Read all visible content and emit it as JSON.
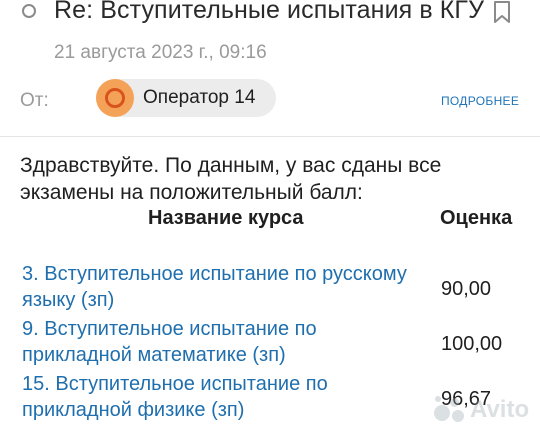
{
  "email": {
    "subject": "Re: Вступительные испытания в КГУ",
    "date": "21 августа 2023 г., 09:16",
    "from_label": "От:",
    "sender_name": "Оператор 14",
    "details_link": "ПОДРОБНЕЕ",
    "greeting": "Здравствуйте. По данным, у вас сданы все экзамены на положительный балл:"
  },
  "table": {
    "headers": {
      "course": "Название курса",
      "grade": "Оценка"
    },
    "rows": [
      {
        "course": "3. Вступительное испытание по русскому языку (зп)",
        "grade": "90,00"
      },
      {
        "course": "9. Вступительное испытание по прикладной математике (зп)",
        "grade": "100,00"
      },
      {
        "course": "15. Вступительное испытание по прикладной физике (зп)",
        "grade": "96,67"
      }
    ]
  },
  "watermark": {
    "text": "Avito"
  },
  "icons": {
    "unread": "unread-dot-icon",
    "bookmark": "bookmark-icon",
    "avatar": "sender-avatar-icon"
  },
  "colors": {
    "link": "#1f6fae",
    "avatar_bg": "#f5a259",
    "avatar_ring": "#d9531e",
    "muted_text": "#9a9a9a"
  }
}
